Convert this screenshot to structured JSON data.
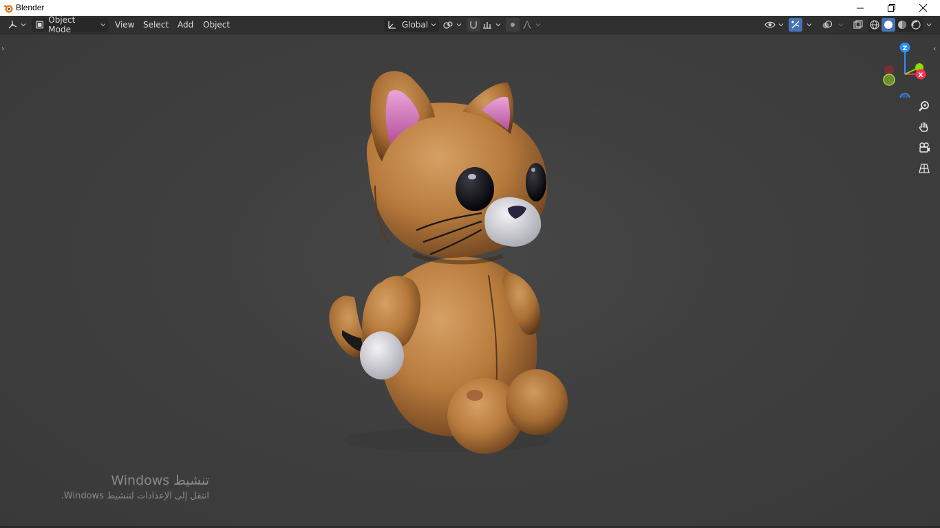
{
  "window": {
    "title": "Blender"
  },
  "header": {
    "editor_type_icon": "3d-viewport-icon",
    "mode": "Object Mode",
    "menus": [
      "View",
      "Select",
      "Add",
      "Object"
    ],
    "transform_orientation": "Global"
  },
  "gizmo": {
    "z": "Z",
    "x": "X"
  },
  "object": {
    "name_icon": "plush-cat-model"
  },
  "watermark": {
    "line1": "تنشيط Windows",
    "line2": "انتقل إلى الإعدادات لتنشيط Windows."
  },
  "colors": {
    "header_bg": "#303030",
    "viewport_bg": "#3d3d3d",
    "accent": "#4772b3",
    "axis_x": "#ff3352",
    "axis_y": "#8bdc00",
    "axis_z": "#2890ff"
  }
}
